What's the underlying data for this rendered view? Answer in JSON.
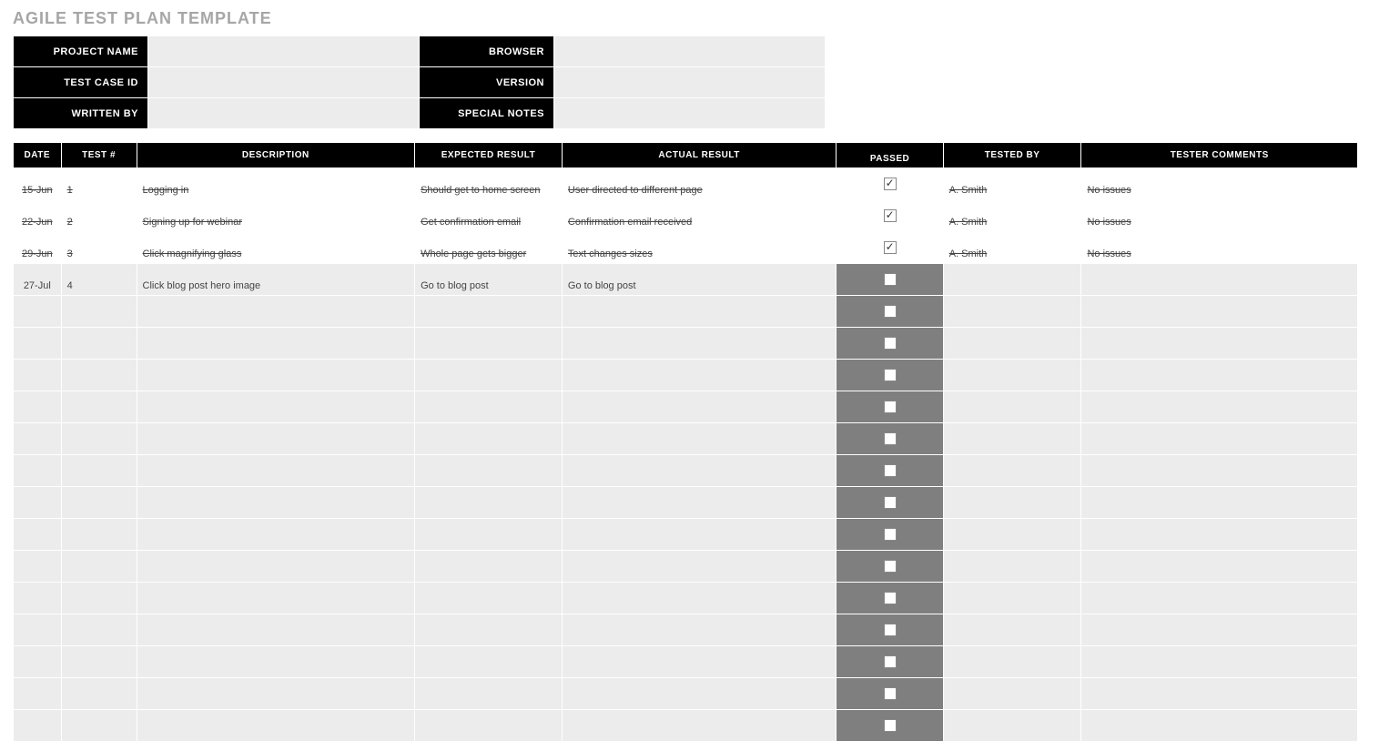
{
  "title": "AGILE TEST PLAN TEMPLATE",
  "meta": {
    "project_name_label": "PROJECT NAME",
    "project_name_value": "",
    "test_case_id_label": "TEST CASE ID",
    "test_case_id_value": "",
    "written_by_label": "WRITTEN BY",
    "written_by_value": "",
    "browser_label": "BROWSER",
    "browser_value": "",
    "version_label": "VERSION",
    "version_value": "",
    "special_notes_label": "SPECIAL NOTES",
    "special_notes_value": ""
  },
  "columns": {
    "date": "DATE",
    "test": "TEST #",
    "description": "DESCRIPTION",
    "expected": "EXPECTED RESULT",
    "actual": "ACTUAL RESULT",
    "passed": "PASSED",
    "tested_by": "TESTED BY",
    "comments": "TESTER COMMENTS"
  },
  "rows": [
    {
      "state": "done",
      "date": "15-Jun",
      "test": "1",
      "description": "Logging in",
      "expected": "Should get to home screen",
      "actual": "User directed to different page",
      "passed": true,
      "tested_by": "A. Smith",
      "comments": "No issues"
    },
    {
      "state": "done",
      "date": "22-Jun",
      "test": "2",
      "description": "Signing up for webinar",
      "expected": "Get confirmation email",
      "actual": "Confirmation email received",
      "passed": true,
      "tested_by": "A. Smith",
      "comments": "No issues"
    },
    {
      "state": "done",
      "date": "29-Jun",
      "test": "3",
      "description": "Click magnifying glass",
      "expected": "Whole page gets bigger",
      "actual": "Text changes sizes",
      "passed": true,
      "tested_by": "A. Smith",
      "comments": "No issues"
    },
    {
      "state": "active",
      "date": "27-Jul",
      "test": "4",
      "description": "Click blog post hero image",
      "expected": "Go to blog post",
      "actual": "Go to blog post",
      "passed": false,
      "tested_by": "",
      "comments": ""
    },
    {
      "state": "empty",
      "date": "",
      "test": "",
      "description": "",
      "expected": "",
      "actual": "",
      "passed": false,
      "tested_by": "",
      "comments": ""
    },
    {
      "state": "empty",
      "date": "",
      "test": "",
      "description": "",
      "expected": "",
      "actual": "",
      "passed": false,
      "tested_by": "",
      "comments": ""
    },
    {
      "state": "empty",
      "date": "",
      "test": "",
      "description": "",
      "expected": "",
      "actual": "",
      "passed": false,
      "tested_by": "",
      "comments": ""
    },
    {
      "state": "empty",
      "date": "",
      "test": "",
      "description": "",
      "expected": "",
      "actual": "",
      "passed": false,
      "tested_by": "",
      "comments": ""
    },
    {
      "state": "empty",
      "date": "",
      "test": "",
      "description": "",
      "expected": "",
      "actual": "",
      "passed": false,
      "tested_by": "",
      "comments": ""
    },
    {
      "state": "empty",
      "date": "",
      "test": "",
      "description": "",
      "expected": "",
      "actual": "",
      "passed": false,
      "tested_by": "",
      "comments": ""
    },
    {
      "state": "empty",
      "date": "",
      "test": "",
      "description": "",
      "expected": "",
      "actual": "",
      "passed": false,
      "tested_by": "",
      "comments": ""
    },
    {
      "state": "empty",
      "date": "",
      "test": "",
      "description": "",
      "expected": "",
      "actual": "",
      "passed": false,
      "tested_by": "",
      "comments": ""
    },
    {
      "state": "empty",
      "date": "",
      "test": "",
      "description": "",
      "expected": "",
      "actual": "",
      "passed": false,
      "tested_by": "",
      "comments": ""
    },
    {
      "state": "empty",
      "date": "",
      "test": "",
      "description": "",
      "expected": "",
      "actual": "",
      "passed": false,
      "tested_by": "",
      "comments": ""
    },
    {
      "state": "empty",
      "date": "",
      "test": "",
      "description": "",
      "expected": "",
      "actual": "",
      "passed": false,
      "tested_by": "",
      "comments": ""
    },
    {
      "state": "empty",
      "date": "",
      "test": "",
      "description": "",
      "expected": "",
      "actual": "",
      "passed": false,
      "tested_by": "",
      "comments": ""
    },
    {
      "state": "empty",
      "date": "",
      "test": "",
      "description": "",
      "expected": "",
      "actual": "",
      "passed": false,
      "tested_by": "",
      "comments": ""
    },
    {
      "state": "empty",
      "date": "",
      "test": "",
      "description": "",
      "expected": "",
      "actual": "",
      "passed": false,
      "tested_by": "",
      "comments": ""
    }
  ]
}
